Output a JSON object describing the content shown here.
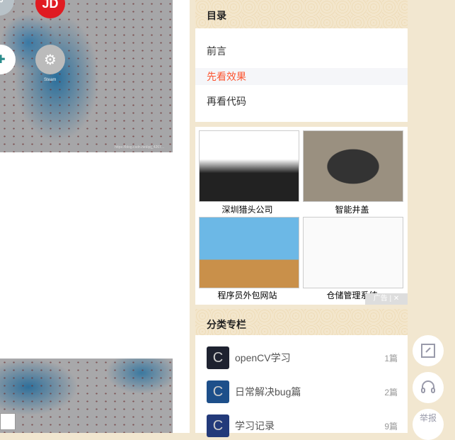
{
  "left": {
    "apps": [
      {
        "label": "JD"
      },
      {
        "label": "Steam"
      }
    ],
    "watermark": "https://blog.csdn.net/qq_4267..."
  },
  "toc": {
    "title": "目录",
    "items": [
      {
        "label": "前言"
      },
      {
        "label": "先看效果",
        "active": true
      },
      {
        "label": "再看代码"
      }
    ]
  },
  "ad": {
    "tiles": [
      {
        "caption": "深圳猎头公司"
      },
      {
        "caption": "智能井盖"
      },
      {
        "caption": "程序员外包网站"
      },
      {
        "caption": "仓储管理系统"
      }
    ],
    "label": "广告",
    "close": "✕"
  },
  "categories": {
    "title": "分类专栏",
    "items": [
      {
        "name": "openCV学习",
        "count": "1篇"
      },
      {
        "name": "日常解决bug篇",
        "count": "2篇"
      },
      {
        "name": "学习记录",
        "count": "9篇"
      }
    ]
  },
  "fab": {
    "report": "举报"
  },
  "colors": {
    "accent": "#fc5531"
  }
}
